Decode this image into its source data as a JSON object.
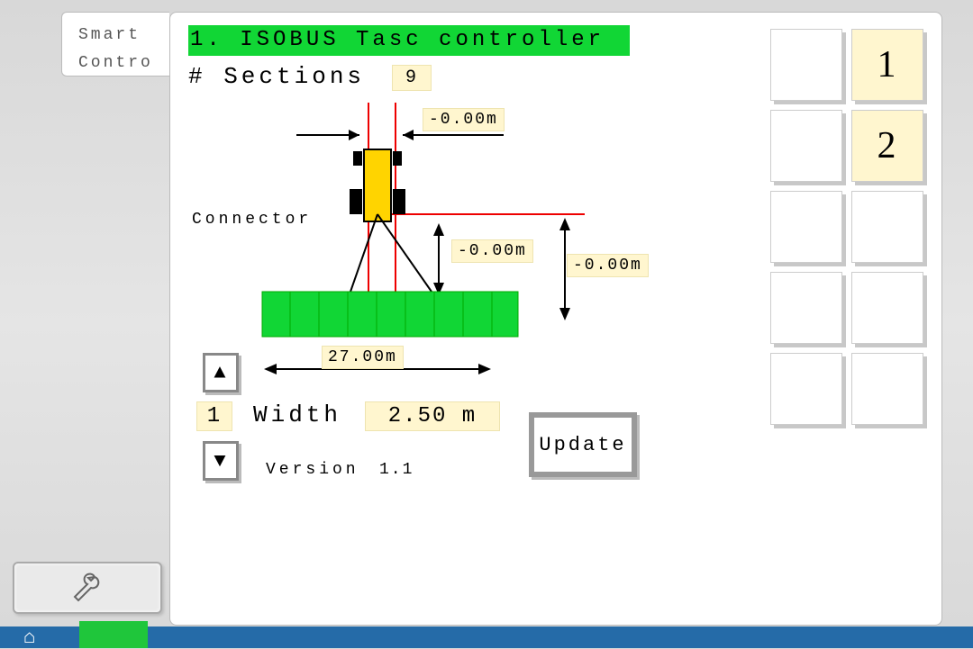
{
  "tab": {
    "line1": "Smart",
    "line2": "Contro"
  },
  "title": "1. ISOBUS Tasc controller",
  "sections": {
    "label": "# Sections",
    "value": "9"
  },
  "connector_label": "Connector",
  "offsets": {
    "x": "-0.00m",
    "y_near": "-0.00m",
    "y_far": "-0.00m"
  },
  "implement": {
    "total_width": "27.00m",
    "section_index": "1",
    "width_label": "Width",
    "width_value": "2.50 m"
  },
  "version": {
    "label": "Version",
    "value": "1.1"
  },
  "buttons": {
    "update": "Update"
  },
  "softkeys": [
    "",
    "1",
    "",
    "2",
    "",
    "",
    "",
    "",
    "",
    ""
  ]
}
